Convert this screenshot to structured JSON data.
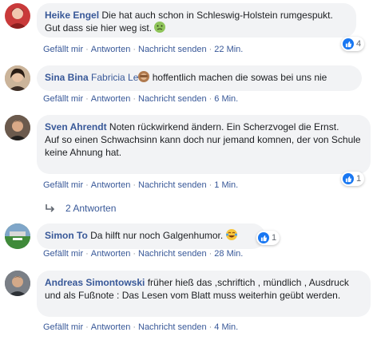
{
  "actions": {
    "like": "Gefällt mir",
    "reply": "Antworten",
    "message": "Nachricht senden",
    "separator": "·"
  },
  "comments": [
    {
      "author": "Heike Engel",
      "text": "Die hat auch schon in Schleswig-Holstein rumgespukt. Gut dass sie hier weg ist.",
      "emoji": "nauseated-face",
      "time": "22 Min.",
      "likes": "4",
      "avatar_color": "#c93a3a"
    },
    {
      "author": "Sina Bina",
      "mention": "Fabricia Le",
      "emoji": "see-no-evil-monkey",
      "text": "hoffentlich machen die sowas bei uns nie",
      "time": "6 Min.",
      "avatar_color": "#a88c72"
    },
    {
      "author": "Sven Ahrendt",
      "text": "Noten rückwirkend ändern. Ein Scherzvogel die Ernst.",
      "text2": "Auf so einen Schwachsinn kann doch nur jemand komnen, der von Schule keine Ahnung hat.",
      "time": "1 Min.",
      "likes": "1",
      "avatar_color": "#5b4a3e",
      "replies": "2 Antworten"
    },
    {
      "author": "Simon To",
      "text": "Da hilft nur noch Galgenhumor.",
      "emoji": "face-with-tears-of-joy",
      "time": "28 Min.",
      "likes": "1",
      "avatar_color": "#2e6b33"
    },
    {
      "author": "Andreas Simontowski",
      "text": "früher hieß das ,schriftich , mündlich , Ausdruck und als Fußnote : Das Lesen vom Blatt muss weiterhin geübt werden.",
      "time": "4 Min.",
      "avatar_color": "#555a60"
    }
  ],
  "colors": {
    "link": "#385898",
    "bubble": "#f2f3f5",
    "like_blue": "#1877f2"
  }
}
